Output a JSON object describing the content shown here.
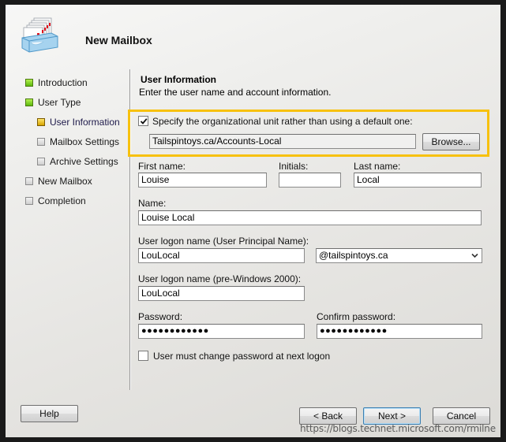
{
  "window": {
    "title": "New Mailbox",
    "icon": "mailbox-tray-icon"
  },
  "sidebar": {
    "steps": [
      {
        "label": "Introduction",
        "state": "done",
        "level": 0
      },
      {
        "label": "User Type",
        "state": "done",
        "level": 0
      },
      {
        "label": "User Information",
        "state": "current",
        "level": 1
      },
      {
        "label": "Mailbox Settings",
        "state": "pending",
        "level": 1
      },
      {
        "label": "Archive Settings",
        "state": "pending",
        "level": 1
      },
      {
        "label": "New Mailbox",
        "state": "pending",
        "level": 0
      },
      {
        "label": "Completion",
        "state": "pending",
        "level": 0
      }
    ]
  },
  "main": {
    "section_title": "User Information",
    "section_description": "Enter the user name and account information.",
    "ou": {
      "checkbox_label": "Specify the organizational unit rather than using a default one:",
      "checked": true,
      "value": "Tailspintoys.ca/Accounts-Local",
      "browse_label": "Browse..."
    },
    "fields": {
      "first_name": {
        "label": "First name:",
        "value": "Louise"
      },
      "initials": {
        "label": "Initials:",
        "value": ""
      },
      "last_name": {
        "label": "Last name:",
        "value": "Local"
      },
      "name": {
        "label": "Name:",
        "value": "Louise Local"
      },
      "upn": {
        "label": "User logon name (User Principal Name):",
        "value": "LouLocal",
        "domain": "@tailspintoys.ca"
      },
      "pre_win2000": {
        "label": "User logon name (pre-Windows 2000):",
        "value": "LouLocal"
      },
      "password": {
        "label": "Password:",
        "value": "●●●●●●●●●●●●"
      },
      "confirm_password": {
        "label": "Confirm password:",
        "value": "●●●●●●●●●●●●"
      }
    },
    "must_change": {
      "label": "User must change password at next logon",
      "checked": false
    }
  },
  "footer": {
    "help_label": "Help",
    "back_label": "< Back",
    "next_label": "Next >",
    "cancel_label": "Cancel"
  },
  "watermark": "https://blogs.technet.microsoft.com/rmilne",
  "colors": {
    "highlight": "#f7c10e",
    "step_done": "#5cb80d",
    "step_current": "#d7a400"
  }
}
